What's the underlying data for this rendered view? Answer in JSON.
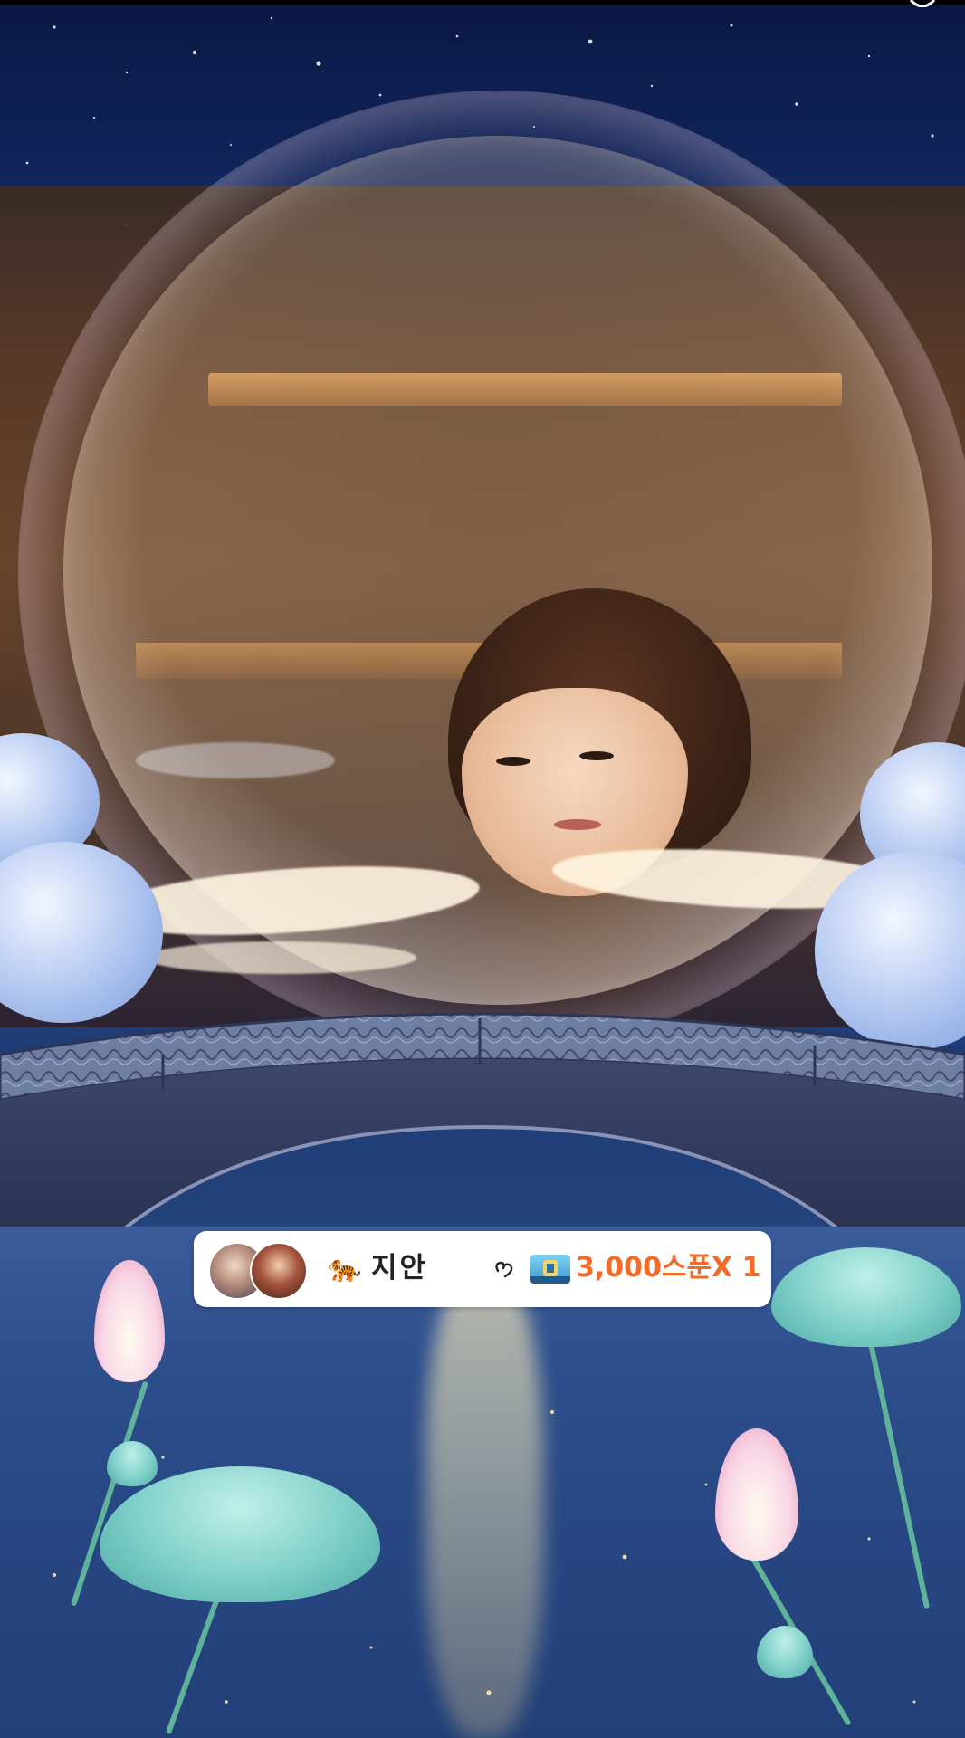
{
  "gift_notice": {
    "sender_name": "지안",
    "gift_amount": "3,000스푼",
    "gift_count": "X 1"
  },
  "icons": {
    "sender_emoji": "🐅",
    "heart": "heart-outline-icon",
    "spoon": "spoon-gift-icon"
  },
  "colors": {
    "gift_text": "#f26b28",
    "notice_background": "#ffffff"
  }
}
